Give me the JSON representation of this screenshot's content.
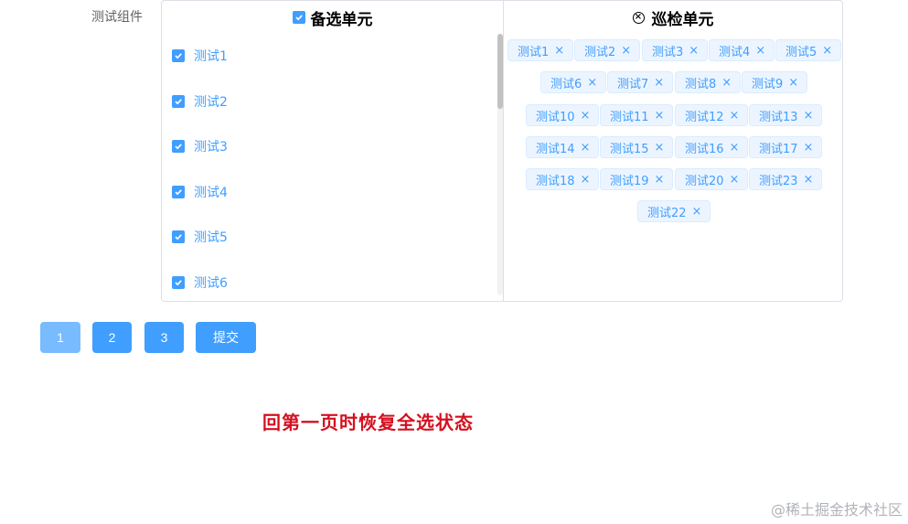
{
  "form": {
    "label": "测试组件"
  },
  "transfer": {
    "left_title": "备选单元",
    "right_title": "巡检单元",
    "left_items": [
      "测试1",
      "测试2",
      "测试3",
      "测试4",
      "测试5",
      "测试6"
    ],
    "right_tags": [
      "测试1",
      "测试2",
      "测试3",
      "测试4",
      "测试5",
      "测试6",
      "测试7",
      "测试8",
      "测试9",
      "测试10",
      "测试11",
      "测试12",
      "测试13",
      "测试14",
      "测试15",
      "测试16",
      "测试17",
      "测试18",
      "测试19",
      "测试20",
      "测试23",
      "测试22"
    ],
    "close_glyph": "×"
  },
  "pagination": {
    "pages": [
      "1",
      "2",
      "3"
    ],
    "current_page": "1",
    "submit_label": "提交"
  },
  "annotation": "回第一页时恢复全选状态",
  "watermark": "@稀土掘金技术社区",
  "colors": {
    "primary": "#409eff",
    "primary_disabled": "#79bbff",
    "tag_bg": "#ecf5ff",
    "annotation_red": "#d4101f"
  },
  "icons": {
    "header_left": "checkbox-checked-icon",
    "header_right": "circle-close-icon",
    "item_check": "checkbox-checked-icon",
    "tag_close": "close-icon"
  }
}
